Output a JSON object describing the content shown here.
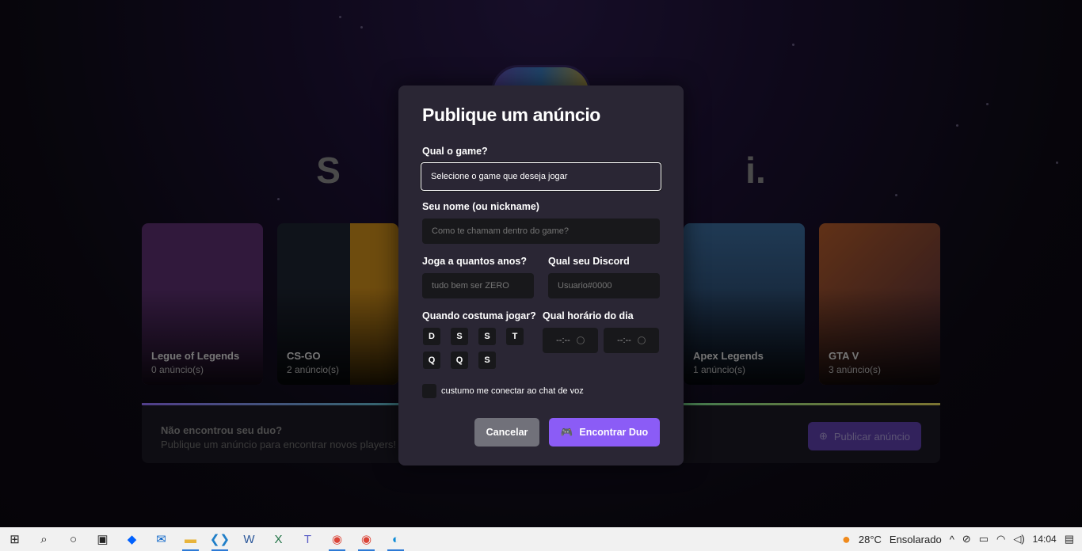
{
  "page": {
    "headline": "S                                        i."
  },
  "games": [
    {
      "name": "Legue of Legends",
      "ads": "0 anúncio(s)",
      "color": "#5a2f6e"
    },
    {
      "name": "CS-GO",
      "ads": "2 anúncio(s)",
      "color": "#c98a1a"
    },
    {
      "name": "",
      "ads": "",
      "color": "#2a2634"
    },
    {
      "name": "",
      "ads": "",
      "color": "#2a2634"
    },
    {
      "name": "Apex Legends",
      "ads": "1 anúncio(s)",
      "color": "#2b4a6a"
    },
    {
      "name": "GTA V",
      "ads": "3 anúncio(s)",
      "color": "#8a3a2a"
    }
  ],
  "banner": {
    "title": "Não encontrou seu duo?",
    "subtitle": "Publique um anúncio para encontrar novos players!",
    "button": "Publicar anúncio"
  },
  "modal": {
    "title": "Publique um anúncio",
    "game_label": "Qual o game?",
    "game_value": "Selecione o game que deseja jogar",
    "name_label": "Seu nome (ou nickname)",
    "name_placeholder": "Como te chamam dentro do game?",
    "years_label": "Joga a quantos anos?",
    "years_placeholder": "tudo bem ser ZERO",
    "discord_label": "Qual seu Discord",
    "discord_placeholder": "Usuario#0000",
    "days_label": "Quando costuma jogar?",
    "days": [
      "D",
      "S",
      "S",
      "T",
      "Q",
      "Q",
      "S"
    ],
    "hours_label": "Qual horário do dia",
    "hour_start": "--:--",
    "hour_end": "--:--",
    "voice_label": "custumo me conectar ao chat de voz",
    "cancel": "Cancelar",
    "submit": "Encontrar Duo"
  },
  "taskbar": {
    "weather_temp": "28°C",
    "weather_text": "Ensolarado",
    "clock": "14:04"
  },
  "colors": {
    "accent": "#8b5cf6",
    "cancel": "#71717a",
    "modal_bg": "#2a2634"
  }
}
